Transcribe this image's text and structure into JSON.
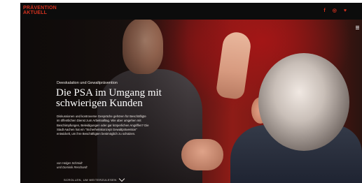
{
  "header": {
    "logo_line1": "PRÄVENTION",
    "logo_line2": "AKTUELL",
    "social": {
      "facebook": "f",
      "instagram": "◎",
      "twitter": "♥"
    },
    "brand_color": "#d6321f"
  },
  "hero": {
    "kicker": "Deeskalation und Gewaltprävention",
    "headline_line1": "Die PSA im Umgang mit",
    "headline_line2": "schwierigen Kunden",
    "teaser": "Diskussionen und kontroverse Gespräche gehören für Beschäftigte im öffentlichen Dienst zum Arbeitsalltag. Wie aber umgehen mit Beschimpfungen, Beleidigungen oder gar körperlichen Angriffen? Die Stadt Aachen hat ein \"Sicherheitskonzept Gewaltprävention\" entwickelt, um ihre Beschäftigten bestmöglich zu schützen.",
    "author1": "von Holger Schmidt",
    "author2": "und Dominik Reschardt",
    "scroll_label": "SCROLLEN, UM WEITERZULESEN"
  },
  "icons": {
    "menu": "hamburger-menu-icon",
    "scroll": "chevron-down-icon"
  }
}
